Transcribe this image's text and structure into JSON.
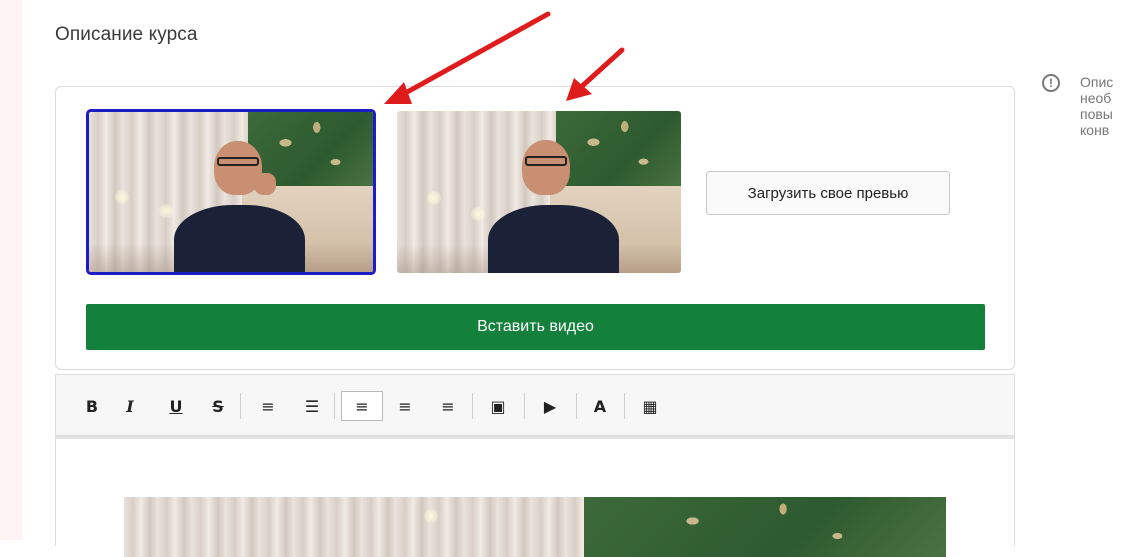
{
  "section": {
    "title": "Описание курса"
  },
  "preview_card": {
    "upload_preview_label": "Загрузить свое превью",
    "insert_video_label": "Вставить видео"
  },
  "toolbar": {
    "buttons": [
      {
        "name": "bold",
        "glyph": "B"
      },
      {
        "name": "italic",
        "glyph": "I"
      },
      {
        "name": "underline",
        "glyph": "U"
      },
      {
        "name": "strikethrough",
        "glyph": "S"
      },
      {
        "name": "ordered-list",
        "glyph": "≡"
      },
      {
        "name": "unordered-list",
        "glyph": "☰"
      },
      {
        "name": "align-left",
        "glyph": "≡",
        "active": true
      },
      {
        "name": "align-center",
        "glyph": "≡"
      },
      {
        "name": "align-right",
        "glyph": "≡"
      },
      {
        "name": "image",
        "glyph": "▣"
      },
      {
        "name": "youtube",
        "glyph": "▶"
      },
      {
        "name": "text-style",
        "glyph": "A"
      },
      {
        "name": "video-file",
        "glyph": "▦"
      }
    ]
  },
  "hint": {
    "text": "Опис\nнеоб\nповы\nконв"
  },
  "colors": {
    "selected_border": "#1c1cc8",
    "insert_button": "#13803b",
    "annotation_arrow": "#e01b1b"
  }
}
